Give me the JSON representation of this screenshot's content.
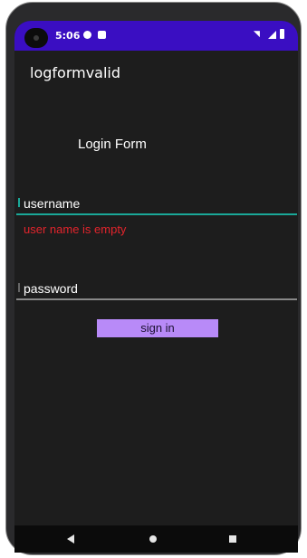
{
  "status_bar": {
    "time": "5:06",
    "icons": [
      "notification-icon",
      "sd-card-icon",
      "wifi-icon",
      "signal-icon",
      "battery-icon"
    ]
  },
  "app": {
    "title": "logformvalid"
  },
  "form": {
    "title": "Login Form",
    "username_label": "username",
    "username_error": "user name is empty",
    "password_label": "password",
    "signin_label": "sign in"
  },
  "colors": {
    "status_bar": "#3a0ec2",
    "background": "#1d1d1d",
    "accent": "#1aa898",
    "error": "#e2242c",
    "button": "#b88af8"
  },
  "nav_bar": {
    "icons": [
      "back-icon",
      "home-icon",
      "recents-icon"
    ]
  }
}
